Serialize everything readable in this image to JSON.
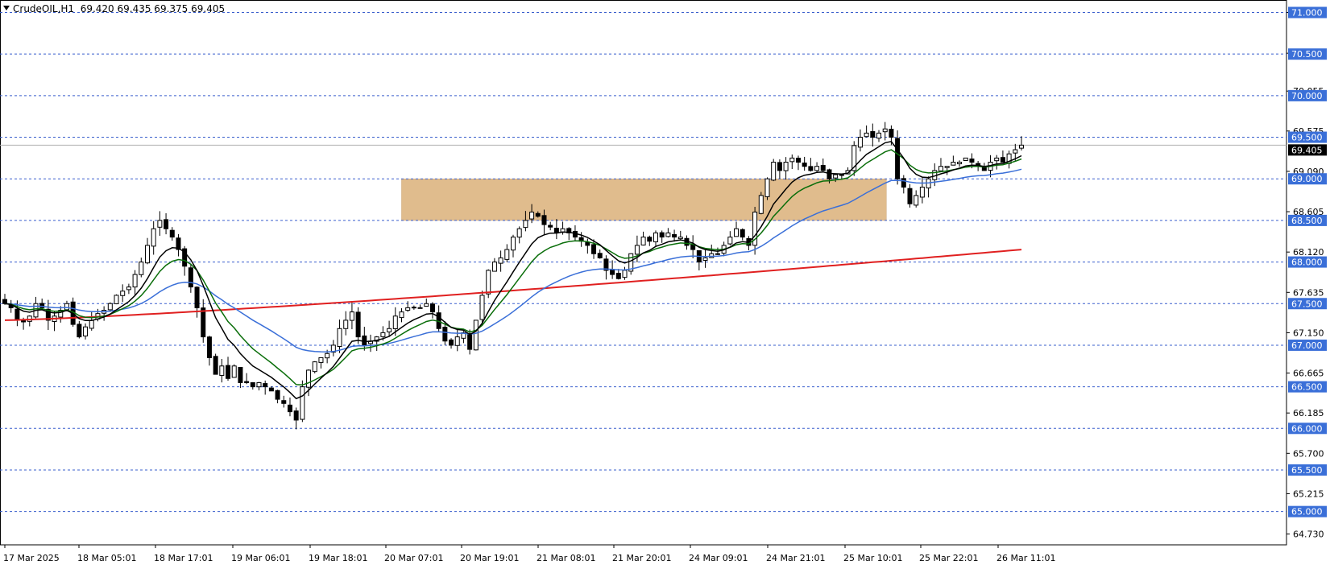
{
  "header": {
    "symbol_timeframe": "CrudeOIL,H1",
    "ohlc": "69.420 69.435 69.375 69.405"
  },
  "colors": {
    "ema_fast": "#000000",
    "ema_mid": "#0a6e0a",
    "ema_slow": "#3a6fd8",
    "ema_long": "#e02020",
    "zone": "#deb887",
    "level_line": "#3a5fcd",
    "level_label_bg": "#3a6fd8",
    "current_label_bg": "#000000"
  },
  "chart_data": {
    "type": "candlestick",
    "symbol": "CrudeOIL",
    "timeframe": "H1",
    "ylim": [
      64.6,
      71.15
    ],
    "y_ticks": [
      "71.000",
      "70.510",
      "70.055",
      "69.575",
      "69.090",
      "68.605",
      "68.120",
      "67.635",
      "67.150",
      "66.665",
      "66.185",
      "65.700",
      "65.215",
      "64.730"
    ],
    "x_ticks": [
      "17 Mar 2025",
      "18 Mar 05:01",
      "18 Mar 17:01",
      "19 Mar 06:01",
      "19 Mar 18:01",
      "20 Mar 07:01",
      "20 Mar 19:01",
      "21 Mar 08:01",
      "21 Mar 20:01",
      "24 Mar 09:01",
      "24 Mar 21:01",
      "25 Mar 10:01",
      "25 Mar 22:01",
      "26 Mar 11:01"
    ],
    "level_lines": [
      "71.000",
      "70.500",
      "70.000",
      "69.500",
      "69.000",
      "68.500",
      "68.000",
      "67.500",
      "67.000",
      "66.500",
      "66.000",
      "65.500",
      "65.000"
    ],
    "current_price": "69.405",
    "zone": {
      "top": 69.0,
      "bottom": 68.5,
      "start_index": 64,
      "end_index": 137
    },
    "candles_close": [
      67.5,
      67.45,
      67.3,
      67.28,
      67.35,
      67.5,
      67.45,
      67.3,
      67.35,
      67.42,
      67.5,
      67.25,
      67.1,
      67.22,
      67.3,
      67.38,
      67.42,
      67.5,
      67.6,
      67.65,
      67.7,
      67.85,
      68.0,
      68.2,
      68.4,
      68.5,
      68.4,
      68.3,
      68.15,
      67.95,
      67.7,
      67.45,
      67.1,
      66.85,
      66.65,
      66.75,
      66.6,
      66.75,
      66.55,
      66.55,
      66.5,
      66.55,
      66.5,
      66.45,
      66.35,
      66.3,
      66.2,
      66.1,
      66.5,
      66.7,
      66.8,
      66.85,
      66.9,
      67.0,
      67.2,
      67.3,
      67.4,
      67.1,
      67.0,
      67.05,
      67.1,
      67.15,
      67.2,
      67.35,
      67.4,
      67.45,
      67.45,
      67.45,
      67.5,
      67.4,
      67.2,
      67.05,
      67.0,
      67.1,
      67.15,
      66.95,
      67.3,
      67.6,
      67.9,
      68.0,
      68.05,
      68.15,
      68.3,
      68.4,
      68.5,
      68.6,
      68.55,
      68.45,
      68.42,
      68.35,
      68.4,
      68.35,
      68.3,
      68.25,
      68.2,
      68.1,
      68.05,
      67.9,
      67.85,
      67.8,
      67.9,
      68.1,
      68.2,
      68.3,
      68.25,
      68.35,
      68.3,
      68.35,
      68.3,
      68.3,
      68.2,
      68.15,
      68.0,
      68.05,
      68.1,
      68.1,
      68.2,
      68.3,
      68.4,
      68.3,
      68.2,
      68.6,
      68.8,
      69.0,
      69.2,
      69.1,
      69.2,
      69.25,
      69.2,
      69.15,
      69.1,
      69.15,
      69.1,
      69.0,
      69.05,
      69.05,
      69.1,
      69.4,
      69.5,
      69.55,
      69.5,
      69.55,
      69.6,
      69.5,
      69.0,
      68.9,
      68.7,
      68.8,
      68.9,
      69.0,
      69.1,
      69.15,
      69.15,
      69.2,
      69.2,
      69.25,
      69.2,
      69.15,
      69.1,
      69.2,
      69.25,
      69.2,
      69.3,
      69.35,
      69.405
    ],
    "series": [
      {
        "name": "EMA fast",
        "color": "#000000"
      },
      {
        "name": "EMA mid",
        "color": "#0a6e0a"
      },
      {
        "name": "EMA slow",
        "color": "#3a6fd8"
      },
      {
        "name": "EMA long",
        "color": "#e02020",
        "values_start": 67.3,
        "values_end": 68.15
      }
    ]
  }
}
